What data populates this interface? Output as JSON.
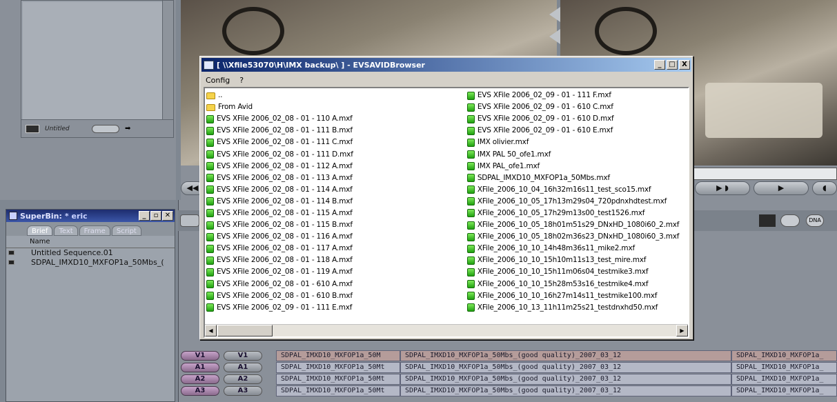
{
  "bin": {
    "untitled_label": "Untitled"
  },
  "timeline_controls": {
    "rewind": "◀◀"
  },
  "superbin": {
    "title_prefix": "SuperBin:",
    "title_name": "* eric",
    "tabs": [
      "Brief",
      "Text",
      "Frame",
      "Script"
    ],
    "column_header": "Name",
    "items": [
      "Untitled Sequence.01",
      "SDPAL_IMXD10_MXFOP1a_50Mbs_("
    ]
  },
  "dialog": {
    "title": "[ \\\\Xfile53070\\H\\IMX backup\\ ] - EVSAVIDBrowser",
    "menu": [
      "Config",
      "?"
    ],
    "window_buttons": [
      "_",
      "□",
      "X"
    ],
    "left_files": [
      {
        "name": "..",
        "type": "folder"
      },
      {
        "name": "From Avid",
        "type": "folder"
      },
      {
        "name": "EVS XFile 2006_02_08 - 01 - 110 A.mxf",
        "type": "mxf"
      },
      {
        "name": "EVS XFile 2006_02_08 - 01 - 111 B.mxf",
        "type": "mxf"
      },
      {
        "name": "EVS XFile 2006_02_08 - 01 - 111 C.mxf",
        "type": "mxf"
      },
      {
        "name": "EVS XFile 2006_02_08 - 01 - 111 D.mxf",
        "type": "mxf"
      },
      {
        "name": "EVS XFile 2006_02_08 - 01 - 112 A.mxf",
        "type": "mxf"
      },
      {
        "name": "EVS XFile 2006_02_08 - 01 - 113 A.mxf",
        "type": "mxf"
      },
      {
        "name": "EVS XFile 2006_02_08 - 01 - 114 A.mxf",
        "type": "mxf"
      },
      {
        "name": "EVS XFile 2006_02_08 - 01 - 114 B.mxf",
        "type": "mxf"
      },
      {
        "name": "EVS XFile 2006_02_08 - 01 - 115 A.mxf",
        "type": "mxf"
      },
      {
        "name": "EVS XFile 2006_02_08 - 01 - 115 B.mxf",
        "type": "mxf"
      },
      {
        "name": "EVS XFile 2006_02_08 - 01 - 116 A.mxf",
        "type": "mxf"
      },
      {
        "name": "EVS XFile 2006_02_08 - 01 - 117 A.mxf",
        "type": "mxf"
      },
      {
        "name": "EVS XFile 2006_02_08 - 01 - 118 A.mxf",
        "type": "mxf"
      },
      {
        "name": "EVS XFile 2006_02_08 - 01 - 119 A.mxf",
        "type": "mxf"
      },
      {
        "name": "EVS XFile 2006_02_08 - 01 - 610 A.mxf",
        "type": "mxf"
      },
      {
        "name": "EVS XFile 2006_02_08 - 01 - 610 B.mxf",
        "type": "mxf"
      },
      {
        "name": "EVS XFile 2006_02_09 - 01 - 111 E.mxf",
        "type": "mxf"
      }
    ],
    "right_files": [
      {
        "name": "EVS XFile 2006_02_09 - 01 - 111 F.mxf",
        "type": "mxf"
      },
      {
        "name": "EVS XFile 2006_02_09 - 01 - 610 C.mxf",
        "type": "mxf"
      },
      {
        "name": "EVS XFile 2006_02_09 - 01 - 610 D.mxf",
        "type": "mxf"
      },
      {
        "name": "EVS XFile 2006_02_09 - 01 - 610 E.mxf",
        "type": "mxf"
      },
      {
        "name": "IMX olivier.mxf",
        "type": "mxf"
      },
      {
        "name": "IMX PAL 50_ofe1.mxf",
        "type": "mxf"
      },
      {
        "name": "IMX PAL_ofe1.mxf",
        "type": "mxf"
      },
      {
        "name": "SDPAL_IMXD10_MXFOP1a_50Mbs.mxf",
        "type": "mxf"
      },
      {
        "name": "XFile_2006_10_04_16h32m16s11_test_sco15.mxf",
        "type": "mxf"
      },
      {
        "name": "XFile_2006_10_05_17h13m29s04_720pdnxhdtest.mxf",
        "type": "mxf"
      },
      {
        "name": "XFile_2006_10_05_17h29m13s00_test1526.mxf",
        "type": "mxf"
      },
      {
        "name": "XFile_2006_10_05_18h01m51s29_DNxHD_1080i60_2.mxf",
        "type": "mxf"
      },
      {
        "name": "XFile_2006_10_05_18h02m36s23_DNxHD_1080i60_3.mxf",
        "type": "mxf"
      },
      {
        "name": "XFile_2006_10_10_14h48m36s11_mike2.mxf",
        "type": "mxf"
      },
      {
        "name": "XFile_2006_10_10_15h10m11s13_test_mire.mxf",
        "type": "mxf"
      },
      {
        "name": "XFile_2006_10_10_15h11m06s04_testmike3.mxf",
        "type": "mxf"
      },
      {
        "name": "XFile_2006_10_10_15h28m53s16_testmike4.mxf",
        "type": "mxf"
      },
      {
        "name": "XFile_2006_10_10_16h27m14s11_testmike100.mxf",
        "type": "mxf"
      },
      {
        "name": "XFile_2006_10_13_11h11m25s21_testdnxhd50.mxf",
        "type": "mxf"
      }
    ]
  },
  "tracks": [
    {
      "src": "V1",
      "rec": "V1",
      "clip1": "SDPAL_IMXD10_MXFOP1a_50M",
      "clip2": "SDPAL_IMXD10_MXFOP1a_50Mbs_(good quality)_2007_03_12",
      "clip3": "SDPAL_IMXD10_MXFOP1a_",
      "video": true
    },
    {
      "src": "A1",
      "rec": "A1",
      "clip1": "SDPAL_IMXD10_MXFOP1a_50Mt",
      "clip2": "SDPAL_IMXD10_MXFOP1a_50Mbs_(good quality)_2007_03_12",
      "clip3": "SDPAL_IMXD10_MXFOP1a_",
      "video": false
    },
    {
      "src": "A2",
      "rec": "A2",
      "clip1": "SDPAL_IMXD10_MXFOP1a_50Mt",
      "clip2": "SDPAL_IMXD10_MXFOP1a_50Mbs_(good quality)_2007_03_12",
      "clip3": "SDPAL_IMXD10_MXFOP1a_",
      "video": false
    },
    {
      "src": "A3",
      "rec": "A3",
      "clip1": "SDPAL_IMXD10_MXFOP1a_50Mt",
      "clip2": "SDPAL_IMXD10_MXFOP1a_50Mbs_(good quality)_2007_03_12",
      "clip3": "SDPAL_IMXD10_MXFOP1a_",
      "video": false
    }
  ],
  "toolbar": {
    "dna_label": "DNA"
  }
}
